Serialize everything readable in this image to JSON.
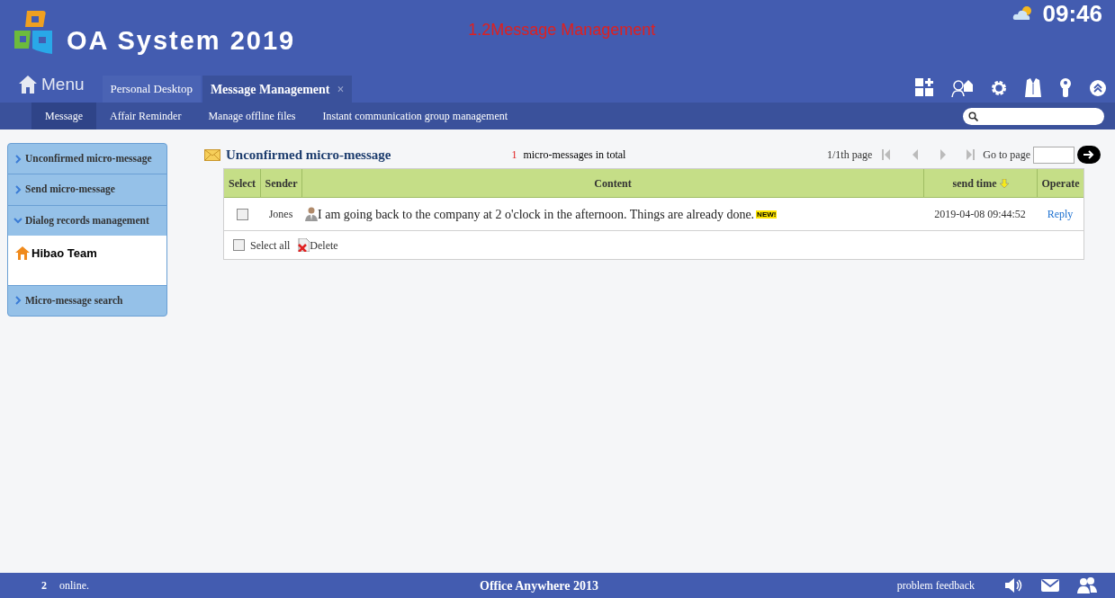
{
  "header": {
    "app_title": "OA System 2019",
    "page_caption": "1.2Message Management",
    "clock": "09:46"
  },
  "menu_label": "Menu",
  "tabs": [
    {
      "label": "Personal Desktop",
      "selected": false,
      "closable": false
    },
    {
      "label": "Message Management",
      "selected": true,
      "closable": true,
      "close_glyph": "×"
    }
  ],
  "subnav": [
    {
      "label": "Message",
      "selected": true
    },
    {
      "label": "Affair Reminder",
      "selected": false
    },
    {
      "label": "Manage offline files",
      "selected": false
    },
    {
      "label": "Instant communication group management",
      "selected": false
    }
  ],
  "sidebar": {
    "items": [
      {
        "label": "Unconfirmed micro-message",
        "expanded": false
      },
      {
        "label": "Send micro-message",
        "expanded": false
      },
      {
        "label": "Dialog records management",
        "expanded": true,
        "children": [
          {
            "label": "Hibao Team"
          }
        ]
      },
      {
        "label": "Micro-message search",
        "expanded": false
      }
    ]
  },
  "main": {
    "title": "Unconfirmed micro-message",
    "total_count": "1",
    "total_label": "micro-messages in total",
    "pager": {
      "page_text": "1/1th page",
      "goto_label": "Go to page"
    },
    "table": {
      "columns": [
        "Select",
        "Sender",
        "Content",
        "send time",
        "Operate"
      ],
      "rows": [
        {
          "checked": false,
          "sender": "Jones",
          "content": "I am going back to the company at 2 o'clock in the afternoon. Things are already done.",
          "new_badge": "NEW!",
          "send_time": "2019-04-08 09:44:52",
          "operate": "Reply"
        }
      ],
      "footer": {
        "select_all_checked": false,
        "select_all_label": "Select all",
        "delete_label": "Delete"
      }
    }
  },
  "status_bar": {
    "online_count": "2",
    "online_label": "online.",
    "product": "Office Anywhere 2013",
    "feedback": "problem feedback"
  }
}
